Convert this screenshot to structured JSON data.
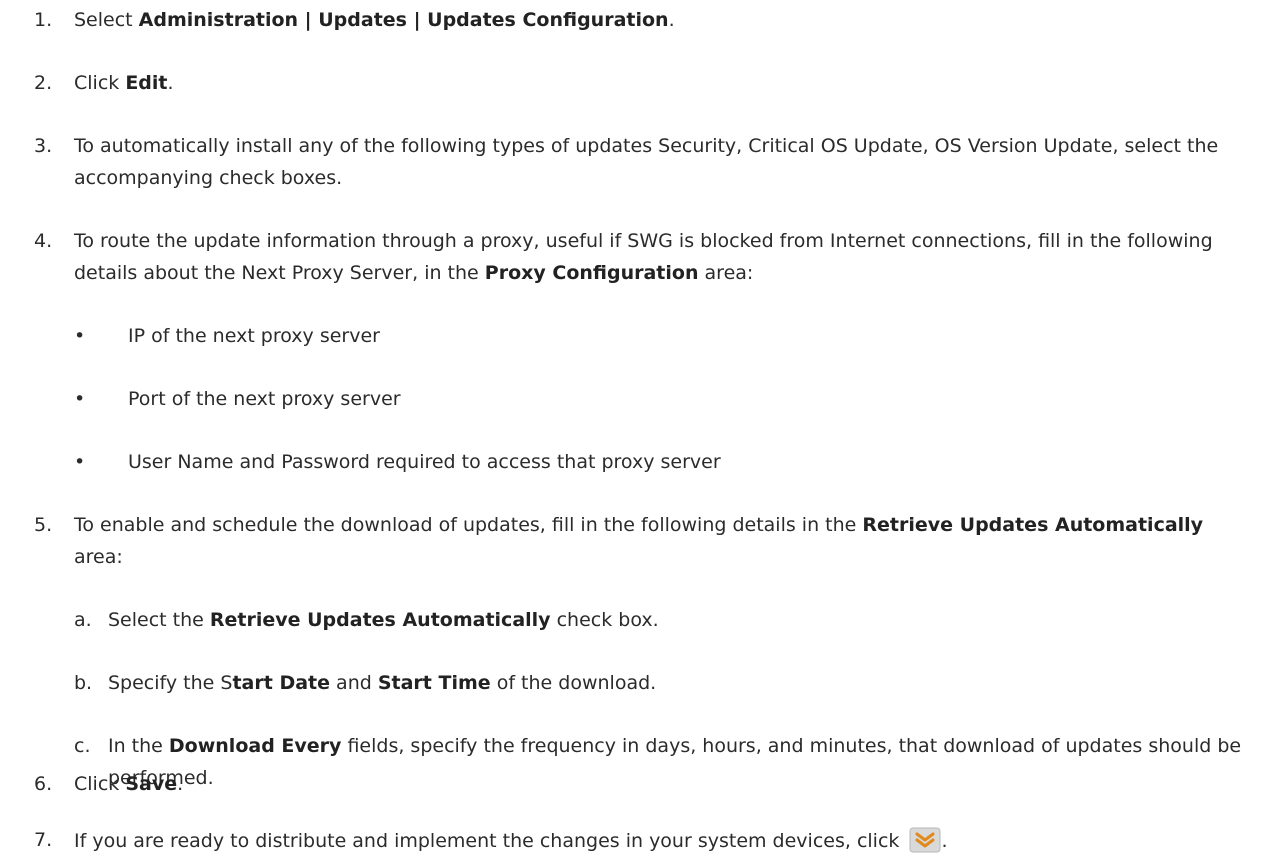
{
  "steps": [
    {
      "num": "1.",
      "parts": [
        "Select ",
        "Administration | Updates | Updates Configuration",
        "."
      ]
    },
    {
      "num": "2.",
      "parts": [
        "Click ",
        "Edit",
        "."
      ]
    },
    {
      "num": "3.",
      "text": "To automatically install any of the following types of updates Security, Critical OS Update, OS Version Update, select the accompanying check boxes."
    },
    {
      "num": "4.",
      "parts": [
        "To route the update information through a proxy, useful if SWG is blocked from Internet connections, fill in the following details about the Next Proxy Server, in the ",
        "Proxy Configuration",
        " area:"
      ],
      "bullets": [
        "IP of the next proxy server",
        "Port of the next proxy server",
        "User Name and Password required to access that proxy server"
      ]
    },
    {
      "num": "5.",
      "parts": [
        "To enable and schedule the download of updates, fill in the following details in the ",
        "Retrieve Updates Automatically",
        " area:"
      ],
      "substeps": [
        {
          "letter": "a.",
          "parts": [
            "Select the ",
            "Retrieve Updates Automatically",
            " check box."
          ]
        },
        {
          "letter": "b.",
          "parts": [
            "Specify the S",
            "tart Date",
            " and ",
            "Start Time",
            " of the download."
          ]
        },
        {
          "letter": "c.",
          "parts": [
            "In the ",
            "Download Every",
            " fields, specify the frequency in days, hours, and minutes, that download of updates should be performed."
          ]
        }
      ]
    },
    {
      "num": "6.",
      "parts": [
        "Click ",
        "Save",
        "."
      ]
    },
    {
      "num": "7.",
      "parts": [
        "If you are ready to distribute and implement the changes in your system devices, click ",
        "."
      ],
      "icon": "commit-changes-icon"
    }
  ],
  "bullet_symbol": "•",
  "colors": {
    "text": "#2b2b2b",
    "icon_bg": "#d9d9d9",
    "icon_chevron": "#e08a1e"
  }
}
